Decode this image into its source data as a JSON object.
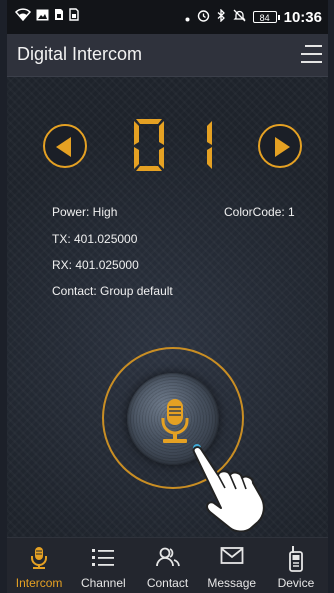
{
  "status_bar": {
    "battery_level": "84",
    "time": "10:36",
    "icons": [
      "wifi-icon",
      "image-icon",
      "sim-icon",
      "sim-icon",
      "dot-icon",
      "alarm-icon",
      "bluetooth-icon",
      "mute-icon",
      "battery-icon"
    ]
  },
  "header": {
    "title": "Digital Intercom"
  },
  "channel": {
    "number": "01"
  },
  "info": {
    "power": "Power: High",
    "color_code": "ColorCode: 1",
    "tx": "TX: 401.025000",
    "rx": "RX: 401.025000",
    "contact": "Contact: Group default"
  },
  "nav": {
    "items": [
      {
        "label": "Intercom",
        "icon": "microphone-icon",
        "active": true
      },
      {
        "label": "Channel",
        "icon": "list-icon",
        "active": false
      },
      {
        "label": "Contact",
        "icon": "contacts-icon",
        "active": false
      },
      {
        "label": "Message",
        "icon": "envelope-icon",
        "active": false
      },
      {
        "label": "Device",
        "icon": "radio-device-icon",
        "active": false
      }
    ]
  },
  "colors": {
    "accent": "#e5a123",
    "background": "#1f232c",
    "header": "#2f323c",
    "status_bar": "#121418"
  }
}
